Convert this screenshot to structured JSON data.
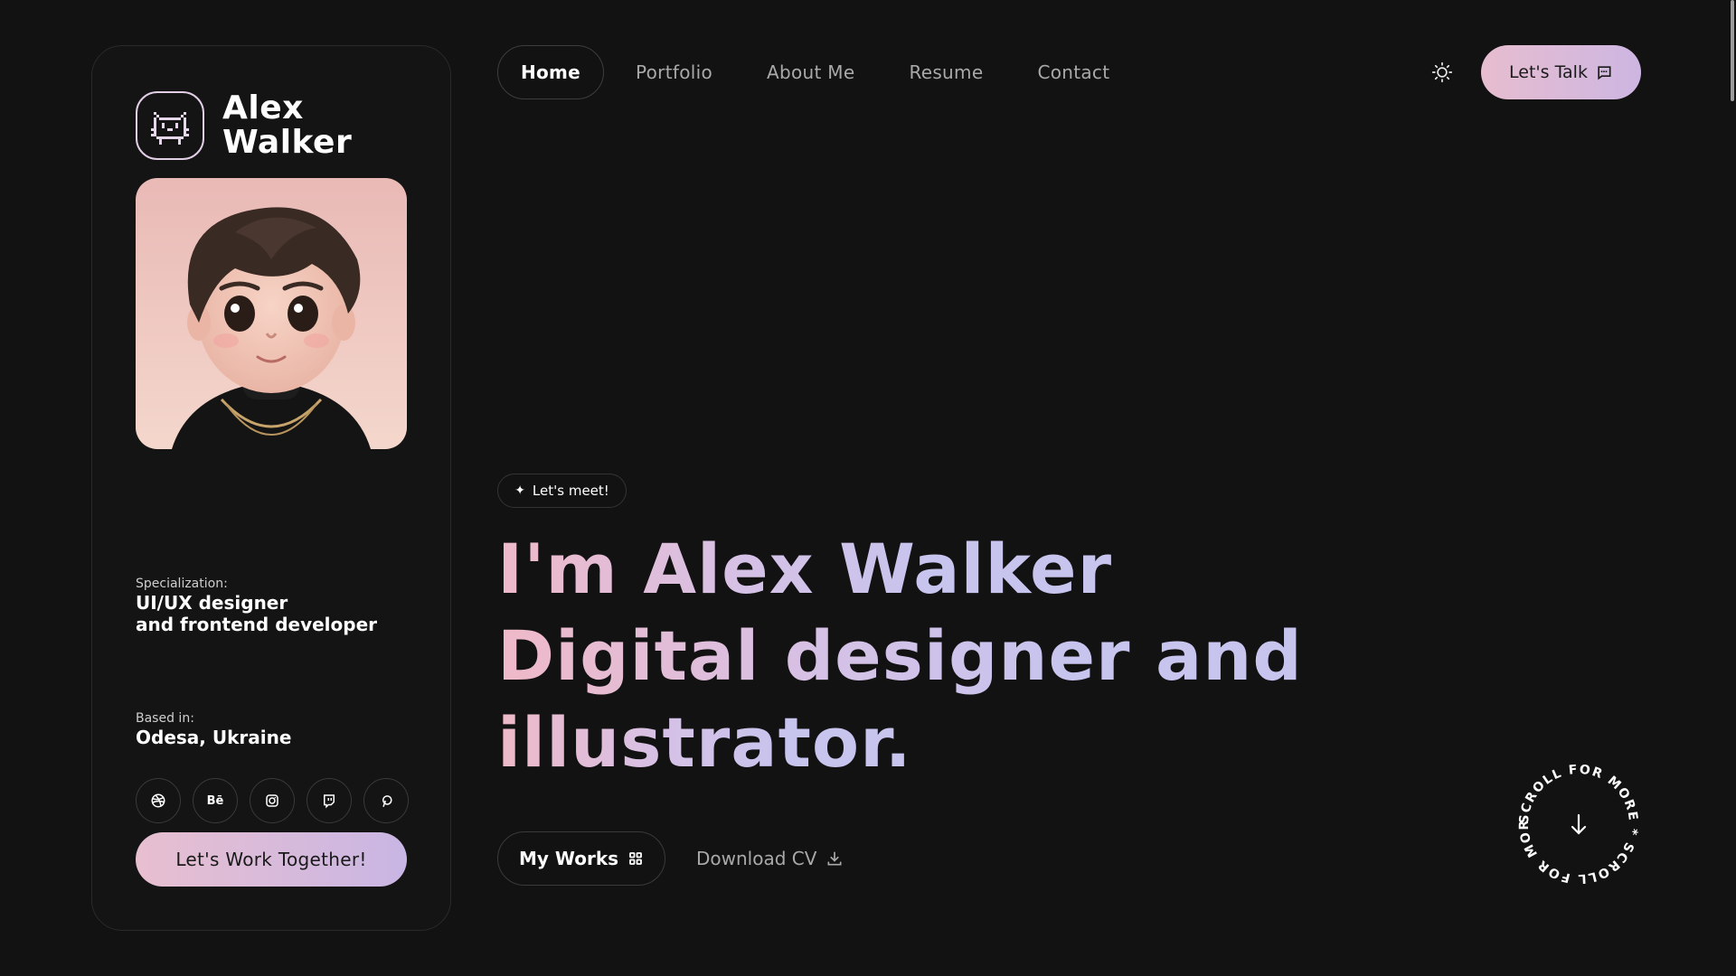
{
  "brand": {
    "first_name": "Alex",
    "last_name": "Walker",
    "logo_icon": "pixel-cat-icon"
  },
  "profile": {
    "avatar_icon": "avatar-illustration",
    "specialization_label": "Specialization:",
    "specialization_line1": "UI/UX designer",
    "specialization_line2": "and frontend developer",
    "based_label": "Based in:",
    "based_value": "Odesa, Ukraine"
  },
  "social": [
    {
      "icon": "dribbble-icon"
    },
    {
      "icon": "behance-icon",
      "text": "Bē"
    },
    {
      "icon": "instagram-icon"
    },
    {
      "icon": "twitch-icon"
    },
    {
      "icon": "pinterest-icon"
    }
  ],
  "sidebar_cta": "Let's Work Together!",
  "nav": {
    "items": [
      "Home",
      "Portfolio",
      "About Me",
      "Resume",
      "Contact"
    ],
    "active": "Home"
  },
  "header": {
    "theme_icon": "sun-icon",
    "talk_label": "Let's Talk",
    "talk_icon": "chat-icon"
  },
  "hero": {
    "badge": "Let's meet!",
    "line1": "I'm Alex Walker",
    "line2": "Digital designer and",
    "line3": "illustrator.",
    "works_label": "My Works",
    "cv_label": "Download CV"
  },
  "scroll": {
    "text": "SCROLL FOR MORE * SCROLL FOR MORE * ",
    "icon": "arrow-down-icon"
  },
  "colors": {
    "accent_pink": "#e8bfd0",
    "accent_lavender": "#c9b6e4",
    "background": "#121212"
  }
}
